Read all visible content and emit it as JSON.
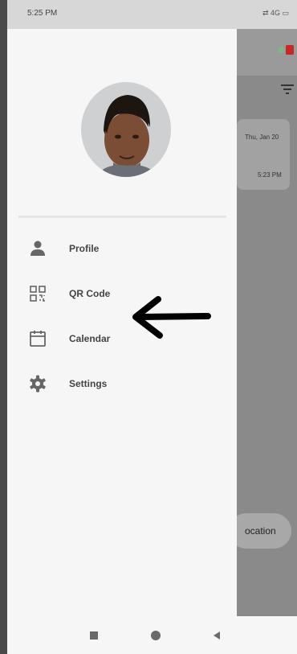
{
  "status_bar": {
    "time": "5:25 PM",
    "icons": "⇄ 4G ▭"
  },
  "background": {
    "card_date": "Thu, Jan 20",
    "card_time": "5:23 PM",
    "location_label": "ocation",
    "filter_icon": "filter-icon"
  },
  "drawer": {
    "menu": [
      {
        "label": "Profile",
        "icon": "person-icon"
      },
      {
        "label": "QR Code",
        "icon": "qr-code-icon"
      },
      {
        "label": "Calendar",
        "icon": "calendar-icon"
      },
      {
        "label": "Settings",
        "icon": "gear-icon"
      }
    ],
    "annotation": "arrow-pointer"
  },
  "nav_bar": {
    "buttons": [
      "recents-button",
      "home-button",
      "back-button"
    ]
  },
  "colors": {
    "drawer_bg": "#f6f6f6",
    "scrim": "#8a8a8a",
    "icon": "#666666",
    "accent_red": "#c62828"
  }
}
